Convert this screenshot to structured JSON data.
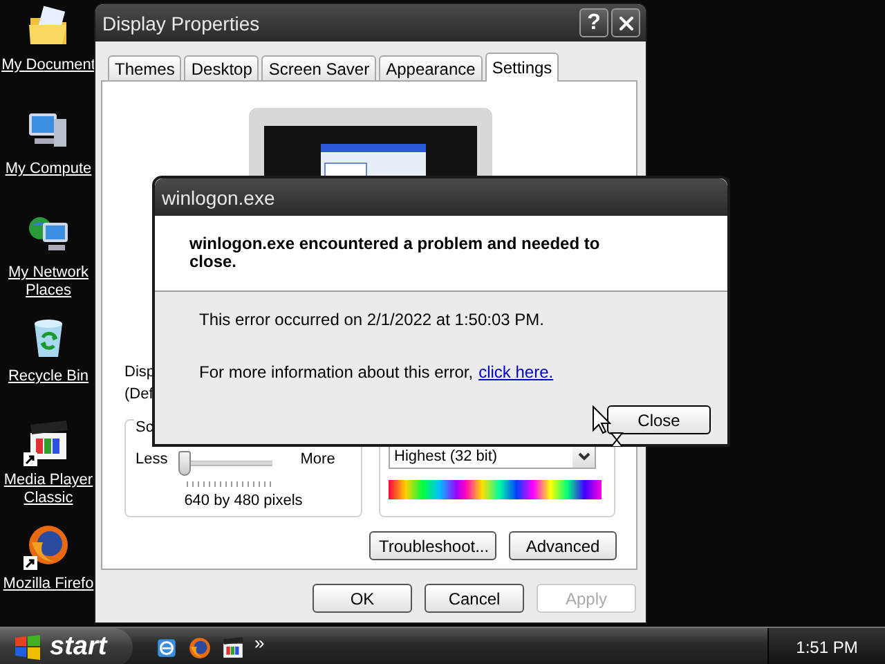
{
  "desktop_icons": [
    {
      "kind": "documents",
      "label": "My Document"
    },
    {
      "kind": "computer",
      "label": "My Compute"
    },
    {
      "kind": "network",
      "label": "My Network Places"
    },
    {
      "kind": "recycle",
      "label": "Recycle Bin"
    },
    {
      "kind": "mediaplayer",
      "label": "Media Player Classic",
      "shortcut": true
    },
    {
      "kind": "firefox",
      "label": "Mozilla Firefo",
      "shortcut": true
    }
  ],
  "display_properties": {
    "title": "Display Properties",
    "help_button": "?",
    "tabs": [
      {
        "label": "Themes",
        "selected": false
      },
      {
        "label": "Desktop",
        "selected": false
      },
      {
        "label": "Screen Saver",
        "selected": false
      },
      {
        "label": "Appearance",
        "selected": false
      },
      {
        "label": "Settings",
        "selected": true
      }
    ],
    "display_text": [
      "Disp",
      "(Def"
    ],
    "screen_resolution": {
      "group_label": "Sc",
      "less": "Less",
      "more": "More",
      "level": 0,
      "reading": "640 by 480 pixels"
    },
    "color_quality": {
      "value": "Highest (32 bit)"
    },
    "panel_buttons": [
      {
        "label": "Troubleshoot...",
        "disabled": false
      },
      {
        "label": "Advanced",
        "disabled": false
      }
    ],
    "buttons": [
      {
        "label": "OK",
        "disabled": false
      },
      {
        "label": "Cancel",
        "disabled": false
      },
      {
        "label": "Apply",
        "disabled": true
      }
    ]
  },
  "error_dialog": {
    "title": "winlogon.exe",
    "heading": "winlogon.exe encountered a problem and needed to close.",
    "occurred": "This error occurred on 2/1/2022 at 1:50:03 PM.",
    "info": "For more information about this error,",
    "link": "click here.",
    "button": "Close"
  },
  "taskbar": {
    "start": "start",
    "quick_launch": [
      {
        "kind": "ie"
      },
      {
        "kind": "firefox"
      },
      {
        "kind": "mediaplayer"
      }
    ],
    "more": "»",
    "clock": "1:51 PM"
  }
}
